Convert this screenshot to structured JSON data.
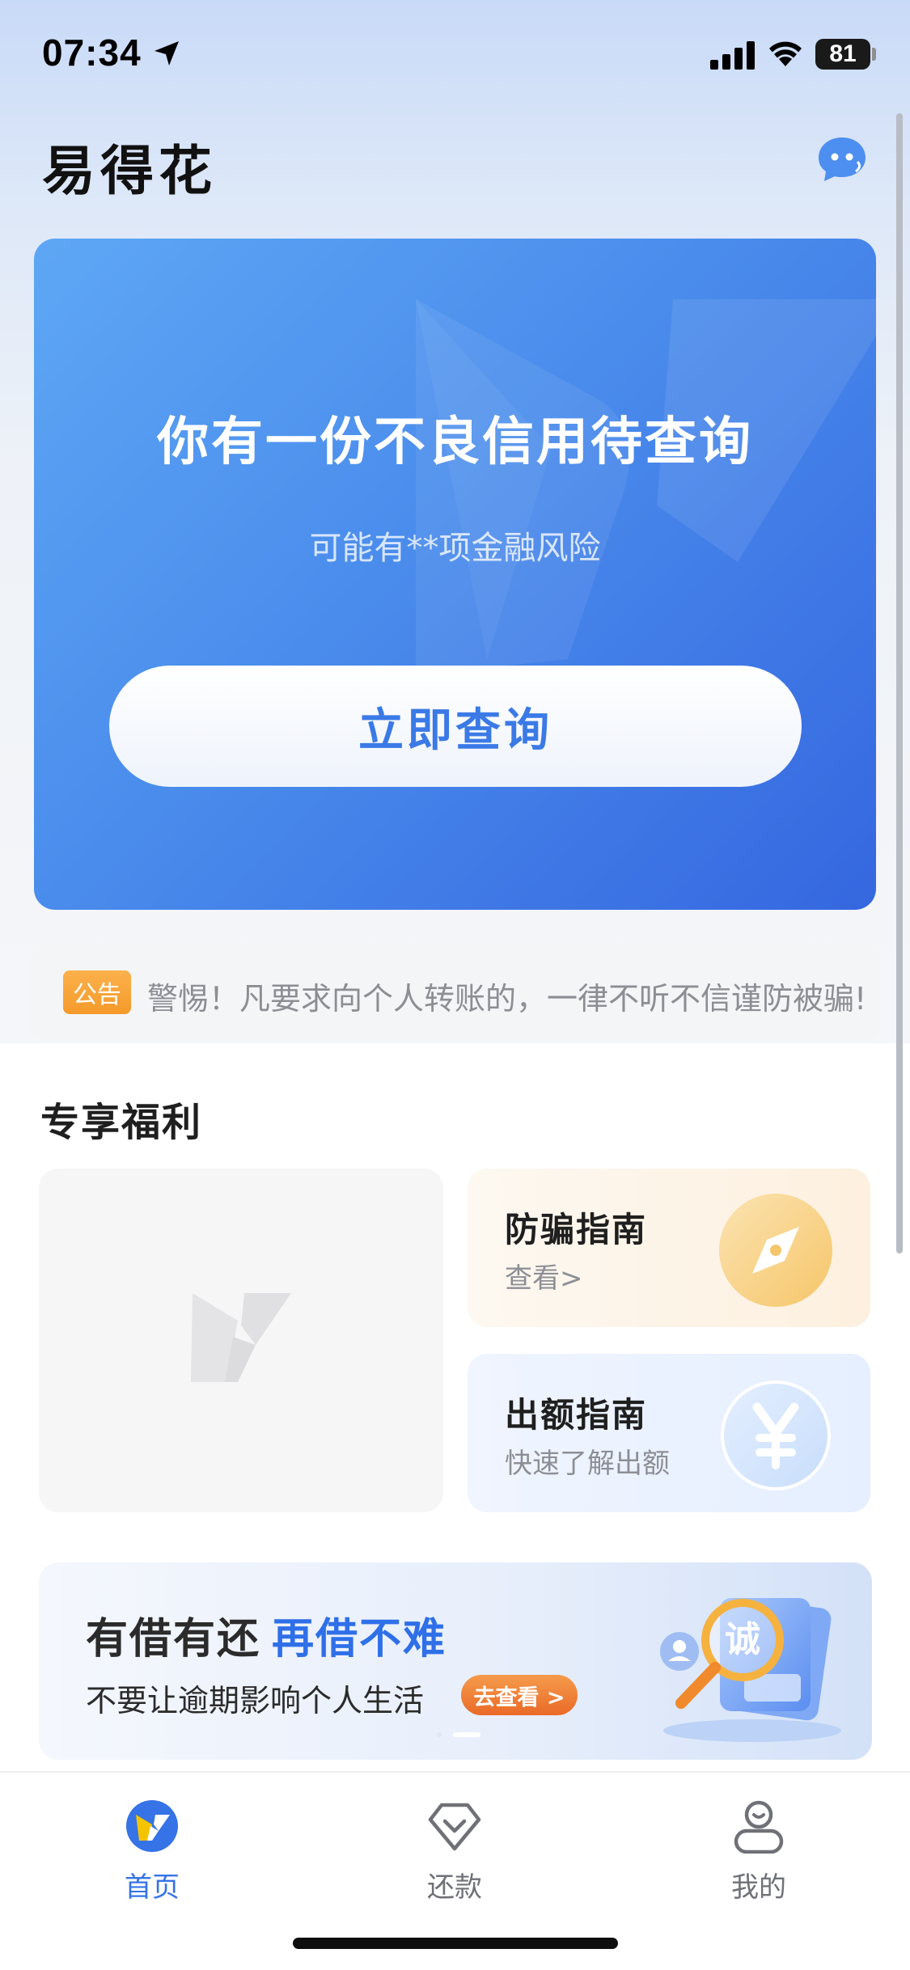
{
  "status_bar": {
    "time": "07:34",
    "battery": "81"
  },
  "header": {
    "title": "易得花",
    "chat_icon": "customer-service-chat-icon"
  },
  "hero": {
    "title": "你有一份不良信用待查询",
    "subtitle": "可能有**项金融风险",
    "button_label": "立即查询"
  },
  "notice": {
    "tag": "公告",
    "text": "警惕！凡要求向个人转账的，一律不听不信谨防被骗!"
  },
  "benefits": {
    "title": "专享福利",
    "cards": [
      {
        "title": "防骗指南",
        "subtitle": "查看>",
        "icon": "compass-icon"
      },
      {
        "title": "出额指南",
        "subtitle": "快速了解出额",
        "icon": "yuan-icon"
      }
    ]
  },
  "promo": {
    "line1_a": "有借有还",
    "line1_b": "再借不难",
    "line2": "不要让逾期影响个人生活",
    "button_label": "去查看 >"
  },
  "tabbar": {
    "tabs": [
      {
        "label": "首页",
        "icon": "home-logo-icon",
        "active": true
      },
      {
        "label": "还款",
        "icon": "repay-diamond-icon",
        "active": false
      },
      {
        "label": "我的",
        "icon": "profile-icon",
        "active": false
      }
    ]
  },
  "colors": {
    "accent": "#3573e6",
    "hero_start": "#5ea7f5",
    "hero_end": "#3567e0",
    "notice_tag": "#f59a2a",
    "promo_button": "#ea6a28"
  }
}
